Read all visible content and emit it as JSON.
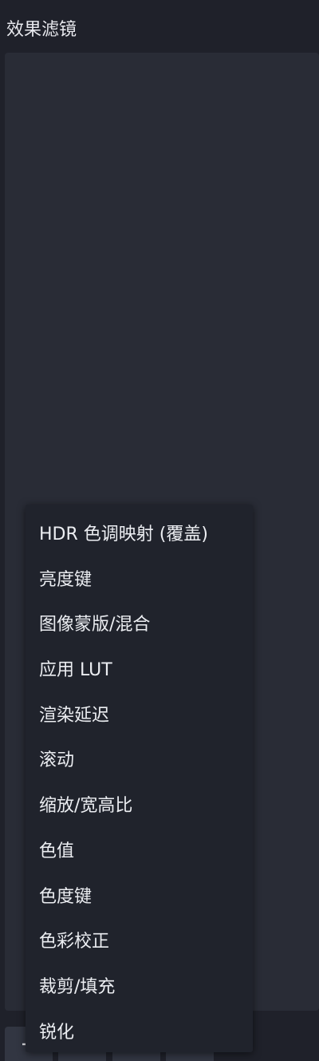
{
  "panel": {
    "title": "效果滤镜"
  },
  "menu": {
    "items": [
      {
        "label": "HDR 色调映射 (覆盖)"
      },
      {
        "label": "亮度键"
      },
      {
        "label": "图像蒙版/混合"
      },
      {
        "label": "应用 LUT"
      },
      {
        "label": "渲染延迟"
      },
      {
        "label": "滚动"
      },
      {
        "label": "缩放/宽高比"
      },
      {
        "label": "色值"
      },
      {
        "label": "色度键"
      },
      {
        "label": "色彩校正"
      },
      {
        "label": "裁剪/填充"
      },
      {
        "label": "锐化"
      }
    ]
  },
  "toolbar": {
    "buttons": [
      {
        "icon": "plus-icon"
      },
      {
        "icon": "trash-icon"
      },
      {
        "icon": "gear-icon"
      },
      {
        "icon": "more-icon"
      }
    ]
  },
  "colors": {
    "background": "#1f212a",
    "list_background": "#292c36",
    "menu_background": "#20232c",
    "text": "#eceef2"
  }
}
